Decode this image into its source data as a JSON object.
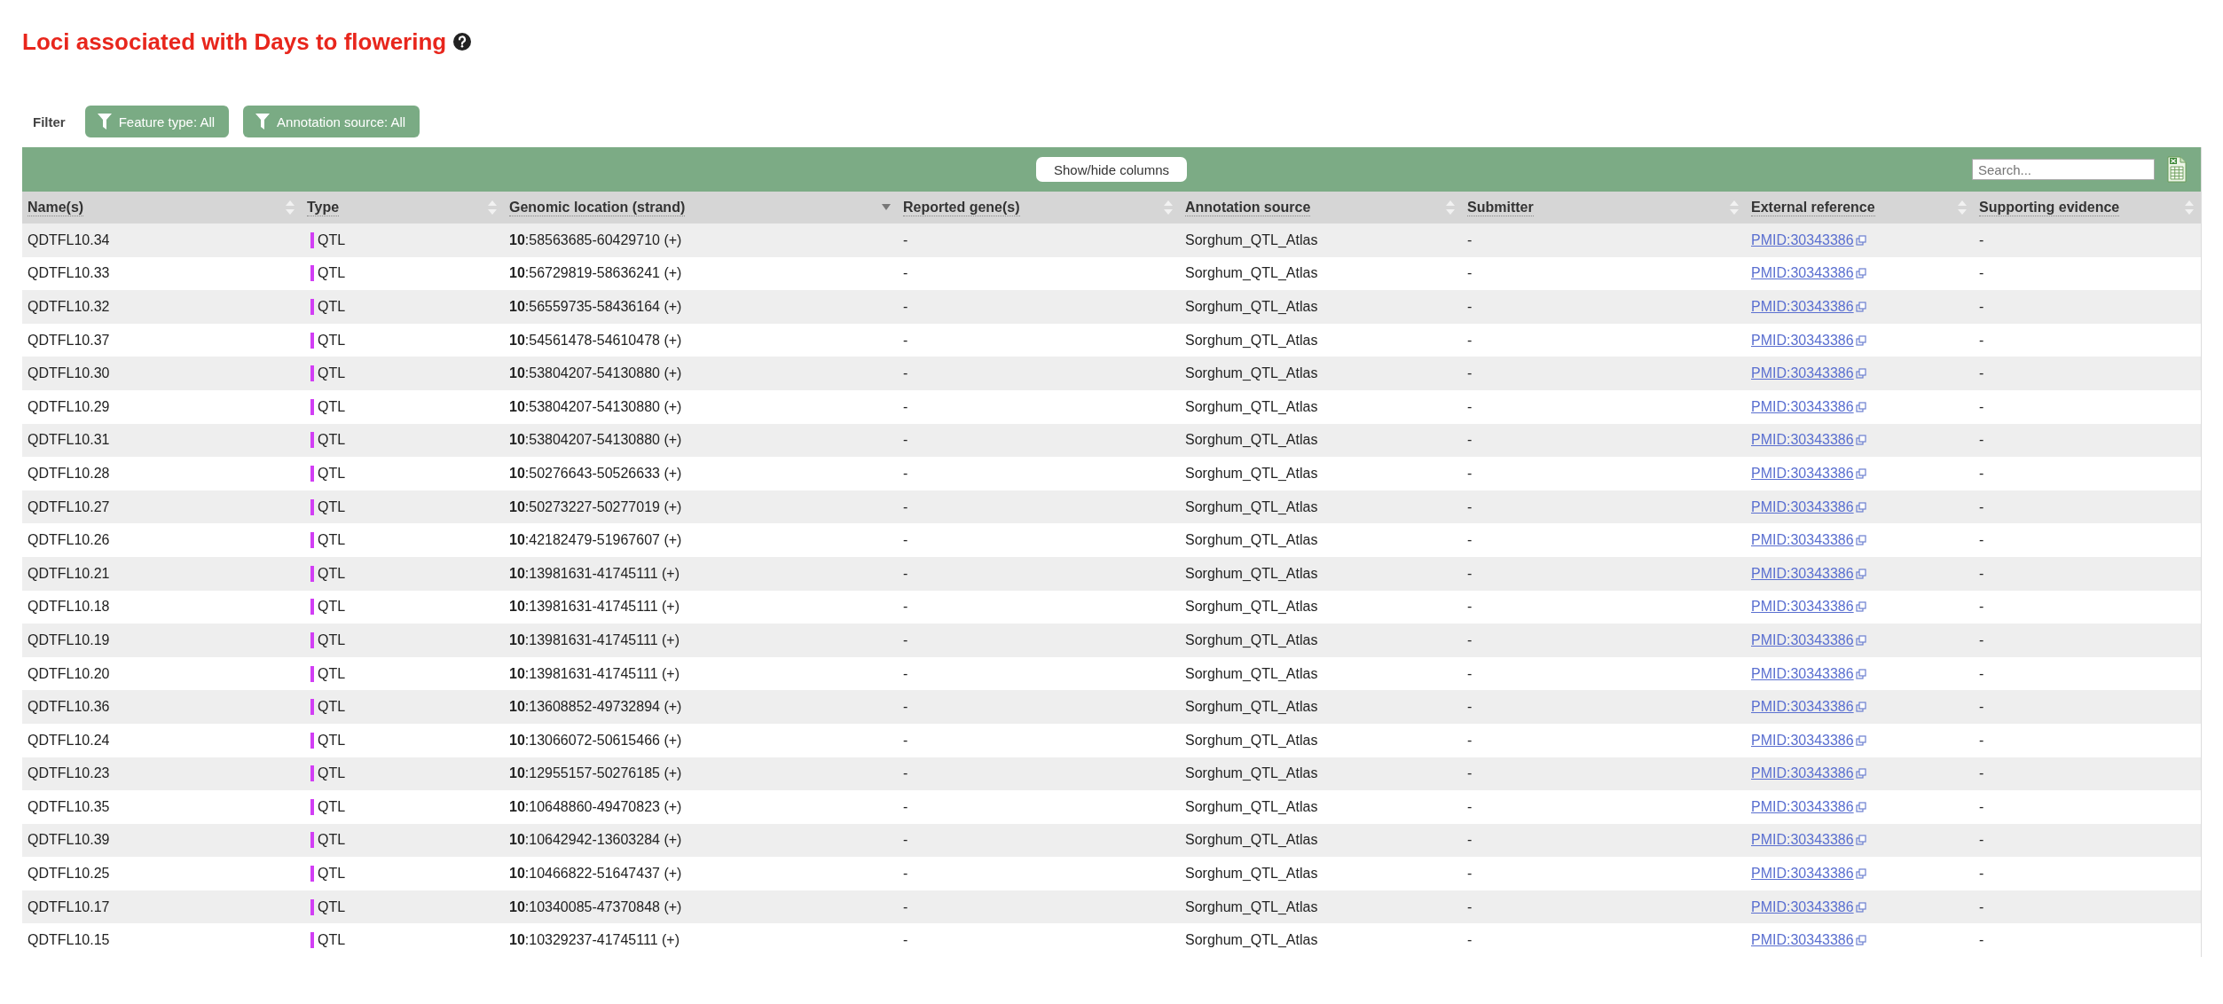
{
  "title": "Loci associated with Days to flowering",
  "filter": {
    "label": "Filter",
    "buttons": [
      "Feature type: All",
      "Annotation source: All"
    ]
  },
  "toolbar": {
    "button": "Show/hide columns",
    "search": {
      "placeholder": "Search..."
    }
  },
  "table": {
    "columns": [
      {
        "label": "Name(s)",
        "sorted": false
      },
      {
        "label": "Type",
        "sorted": false
      },
      {
        "label": "Genomic location (strand)",
        "sorted": true
      },
      {
        "label": "Reported gene(s)",
        "sorted": false
      },
      {
        "label": "Annotation source",
        "sorted": false
      },
      {
        "label": "Submitter",
        "sorted": false
      },
      {
        "label": "External reference",
        "sorted": false
      },
      {
        "label": "Supporting evidence",
        "sorted": false
      }
    ],
    "rows": [
      {
        "name": "QDTFL10.34",
        "type": "QTL",
        "color": "#d23ef5",
        "location": "**10**:58563685-60429710 (+)",
        "genes": "-",
        "source": "Sorghum_QTL_Atlas",
        "submitter": "-",
        "reference": "PMID:30343386",
        "evidence": "-"
      },
      {
        "name": "QDTFL10.33",
        "type": "QTL",
        "color": "#d23ef5",
        "location": "**10**:56729819-58636241 (+)",
        "genes": "-",
        "source": "Sorghum_QTL_Atlas",
        "submitter": "-",
        "reference": "PMID:30343386",
        "evidence": "-"
      },
      {
        "name": "QDTFL10.32",
        "type": "QTL",
        "color": "#d23ef5",
        "location": "**10**:56559735-58436164 (+)",
        "genes": "-",
        "source": "Sorghum_QTL_Atlas",
        "submitter": "-",
        "reference": "PMID:30343386",
        "evidence": "-"
      },
      {
        "name": "QDTFL10.37",
        "type": "QTL",
        "color": "#d23ef5",
        "location": "**10**:54561478-54610478 (+)",
        "genes": "-",
        "source": "Sorghum_QTL_Atlas",
        "submitter": "-",
        "reference": "PMID:30343386",
        "evidence": "-"
      },
      {
        "name": "QDTFL10.30",
        "type": "QTL",
        "color": "#d23ef5",
        "location": "**10**:53804207-54130880 (+)",
        "genes": "-",
        "source": "Sorghum_QTL_Atlas",
        "submitter": "-",
        "reference": "PMID:30343386",
        "evidence": "-"
      },
      {
        "name": "QDTFL10.29",
        "type": "QTL",
        "color": "#d23ef5",
        "location": "**10**:53804207-54130880 (+)",
        "genes": "-",
        "source": "Sorghum_QTL_Atlas",
        "submitter": "-",
        "reference": "PMID:30343386",
        "evidence": "-"
      },
      {
        "name": "QDTFL10.31",
        "type": "QTL",
        "color": "#d23ef5",
        "location": "**10**:53804207-54130880 (+)",
        "genes": "-",
        "source": "Sorghum_QTL_Atlas",
        "submitter": "-",
        "reference": "PMID:30343386",
        "evidence": "-"
      },
      {
        "name": "QDTFL10.28",
        "type": "QTL",
        "color": "#d23ef5",
        "location": "**10**:50276643-50526633 (+)",
        "genes": "-",
        "source": "Sorghum_QTL_Atlas",
        "submitter": "-",
        "reference": "PMID:30343386",
        "evidence": "-"
      },
      {
        "name": "QDTFL10.27",
        "type": "QTL",
        "color": "#d23ef5",
        "location": "**10**:50273227-50277019 (+)",
        "genes": "-",
        "source": "Sorghum_QTL_Atlas",
        "submitter": "-",
        "reference": "PMID:30343386",
        "evidence": "-"
      },
      {
        "name": "QDTFL10.26",
        "type": "QTL",
        "color": "#d23ef5",
        "location": "**10**:42182479-51967607 (+)",
        "genes": "-",
        "source": "Sorghum_QTL_Atlas",
        "submitter": "-",
        "reference": "PMID:30343386",
        "evidence": "-"
      },
      {
        "name": "QDTFL10.21",
        "type": "QTL",
        "color": "#d23ef5",
        "location": "**10**:13981631-41745111 (+)",
        "genes": "-",
        "source": "Sorghum_QTL_Atlas",
        "submitter": "-",
        "reference": "PMID:30343386",
        "evidence": "-"
      },
      {
        "name": "QDTFL10.18",
        "type": "QTL",
        "color": "#d23ef5",
        "location": "**10**:13981631-41745111 (+)",
        "genes": "-",
        "source": "Sorghum_QTL_Atlas",
        "submitter": "-",
        "reference": "PMID:30343386",
        "evidence": "-"
      },
      {
        "name": "QDTFL10.19",
        "type": "QTL",
        "color": "#d23ef5",
        "location": "**10**:13981631-41745111 (+)",
        "genes": "-",
        "source": "Sorghum_QTL_Atlas",
        "submitter": "-",
        "reference": "PMID:30343386",
        "evidence": "-"
      },
      {
        "name": "QDTFL10.20",
        "type": "QTL",
        "color": "#d23ef5",
        "location": "**10**:13981631-41745111 (+)",
        "genes": "-",
        "source": "Sorghum_QTL_Atlas",
        "submitter": "-",
        "reference": "PMID:30343386",
        "evidence": "-"
      },
      {
        "name": "QDTFL10.36",
        "type": "QTL",
        "color": "#d23ef5",
        "location": "**10**:13608852-49732894 (+)",
        "genes": "-",
        "source": "Sorghum_QTL_Atlas",
        "submitter": "-",
        "reference": "PMID:30343386",
        "evidence": "-"
      },
      {
        "name": "QDTFL10.24",
        "type": "QTL",
        "color": "#d23ef5",
        "location": "**10**:13066072-50615466 (+)",
        "genes": "-",
        "source": "Sorghum_QTL_Atlas",
        "submitter": "-",
        "reference": "PMID:30343386",
        "evidence": "-"
      },
      {
        "name": "QDTFL10.23",
        "type": "QTL",
        "color": "#d23ef5",
        "location": "**10**:12955157-50276185 (+)",
        "genes": "-",
        "source": "Sorghum_QTL_Atlas",
        "submitter": "-",
        "reference": "PMID:30343386",
        "evidence": "-"
      },
      {
        "name": "QDTFL10.35",
        "type": "QTL",
        "color": "#d23ef5",
        "location": "**10**:10648860-49470823 (+)",
        "genes": "-",
        "source": "Sorghum_QTL_Atlas",
        "submitter": "-",
        "reference": "PMID:30343386",
        "evidence": "-"
      },
      {
        "name": "QDTFL10.39",
        "type": "QTL",
        "color": "#d23ef5",
        "location": "**10**:10642942-13603284 (+)",
        "genes": "-",
        "source": "Sorghum_QTL_Atlas",
        "submitter": "-",
        "reference": "PMID:30343386",
        "evidence": "-"
      },
      {
        "name": "QDTFL10.25",
        "type": "QTL",
        "color": "#d23ef5",
        "location": "**10**:10466822-51647437 (+)",
        "genes": "-",
        "source": "Sorghum_QTL_Atlas",
        "submitter": "-",
        "reference": "PMID:30343386",
        "evidence": "-"
      },
      {
        "name": "QDTFL10.17",
        "type": "QTL",
        "color": "#d23ef5",
        "location": "**10**:10340085-47370848 (+)",
        "genes": "-",
        "source": "Sorghum_QTL_Atlas",
        "submitter": "-",
        "reference": "PMID:30343386",
        "evidence": "-"
      },
      {
        "name": "QDTFL10.15",
        "type": "QTL",
        "color": "#d23ef5",
        "location": "**10**:10329237-41745111 (+)",
        "genes": "-",
        "source": "Sorghum_QTL_Atlas",
        "submitter": "-",
        "reference": "PMID:30343386",
        "evidence": "-"
      }
    ]
  }
}
